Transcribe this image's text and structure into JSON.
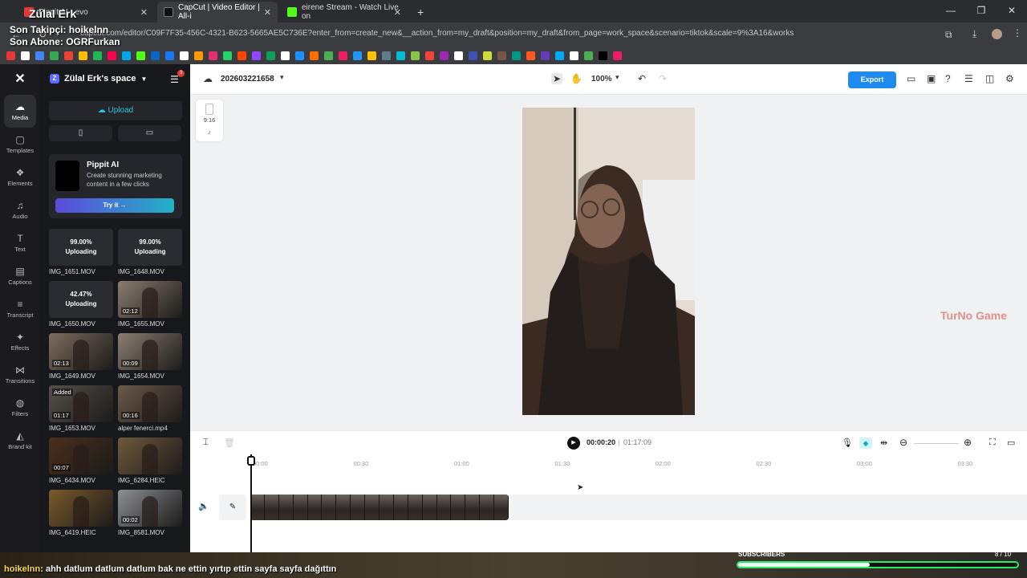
{
  "browser": {
    "tabs": [
      {
        "title": "Pippit AI · evo",
        "color": "#e53935"
      },
      {
        "title": "CapCut | Video Editor | All-i",
        "color": "#111111",
        "active": true
      },
      {
        "title": "eirene Stream - Watch Live on",
        "color": "#53fc18"
      }
    ],
    "new_tab": "+",
    "url": "capcut.com/editor/C09F7F35-456C-4321-B623-5665AE5C736E?enter_from=create_new&__action_from=my_draft&position=my_draft&from_page=work_space&scenario=tiktok&scale=9%3A16&workspaceId=7250..."
  },
  "stream": {
    "channel": "Zülal Erk",
    "follower_line": "Son Takipçi: hoikelnn",
    "subscriber_line": "Son Abone: OGRFurkan",
    "chat_user": "hoikelnn",
    "chat_message": ": ahh datlum datlum datlum bak ne ettin yırtıp ettin sayfa sayfa dağıttın",
    "subs_label": "SUBSCRIBERS",
    "subs_count": "8 / 10",
    "subs_progress": 0.47
  },
  "rail": [
    {
      "label": "Media",
      "icon": "cloud-icon",
      "active": true
    },
    {
      "label": "Templates",
      "icon": "templates-icon"
    },
    {
      "label": "Elements",
      "icon": "elements-icon"
    },
    {
      "label": "Audio",
      "icon": "music-icon"
    },
    {
      "label": "Text",
      "icon": "text-icon"
    },
    {
      "label": "Captions",
      "icon": "captions-icon"
    },
    {
      "label": "Transcript",
      "icon": "transcript-icon"
    },
    {
      "label": "Effects",
      "icon": "effects-icon"
    },
    {
      "label": "Transitions",
      "icon": "transitions-icon"
    },
    {
      "label": "Filters",
      "icon": "filters-icon"
    },
    {
      "label": "Brand kit",
      "icon": "brand-kit-icon"
    }
  ],
  "panel": {
    "space": "Zülal Erk's space",
    "notif_count": "3",
    "upload": "Upload",
    "pippit": {
      "title": "Pippit AI",
      "desc": "Create stunning marketing content in a few clicks",
      "cta": "Try it →"
    },
    "media": [
      {
        "name": "IMG_1651.MOV",
        "status": "99.00%",
        "sub": "Uploading"
      },
      {
        "name": "IMG_1648.MOV",
        "status": "99.00%",
        "sub": "Uploading"
      },
      {
        "name": "IMG_1650.MOV",
        "status": "42.47%",
        "sub": "Uploading"
      },
      {
        "name": "IMG_1655.MOV",
        "duration": "02:12"
      },
      {
        "name": "IMG_1649.MOV",
        "duration": "02:13"
      },
      {
        "name": "IMG_1654.MOV",
        "duration": "00:09"
      },
      {
        "name": "IMG_1653.MOV",
        "duration": "01:17",
        "added": "Added"
      },
      {
        "name": "alper fenerci.mp4",
        "duration": "00:16"
      },
      {
        "name": "IMG_6434.MOV",
        "duration": "00:07"
      },
      {
        "name": "IMG_6284.HEIC"
      },
      {
        "name": "IMG_6419.HEIC"
      },
      {
        "name": "IMG_8581.MOV",
        "duration": "00:02"
      }
    ]
  },
  "editor": {
    "project": "202603221658",
    "zoom": "100%",
    "export": "Export",
    "ratio": "9:16",
    "current_time": "00:00:20",
    "separator": "|",
    "total_time": "01:17:09",
    "ticks": [
      "00:00",
      "00:30",
      "01:00",
      "01:30",
      "02:00",
      "02:30",
      "03:00",
      "03:30"
    ],
    "watermark": "TurNo Game"
  }
}
